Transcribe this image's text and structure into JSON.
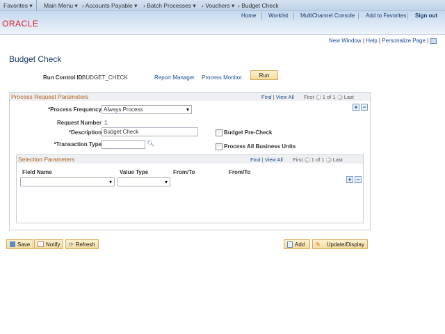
{
  "nav": {
    "favorites": "Favorites",
    "main_menu": "Main Menu",
    "crumbs": [
      "Accounts Payable",
      "Batch Processes",
      "Vouchers"
    ],
    "current": "Budget Check"
  },
  "header": {
    "links": [
      "Home",
      "Worklist",
      "MultiChannel Console",
      "Add to Favorites"
    ],
    "sign_out": "Sign out",
    "logo": "ORACLE"
  },
  "util": {
    "new_window": "New Window",
    "help": "Help",
    "personalize": "Personalize Page"
  },
  "page": {
    "title": "Budget Check",
    "run_control_label": "Run Control ID",
    "run_control_value": "BUDGET_CHECK",
    "report_manager": "Report Manager",
    "process_monitor": "Process Monitor",
    "run": "Run"
  },
  "prp": {
    "title": "Process Request Parameters",
    "find": "Find",
    "view_all": "View All",
    "first": "First",
    "count": "1 of 1",
    "last": "Last",
    "freq_label": "*Process Frequency",
    "freq_value": "Always Process",
    "reqnum_label": "Request Number",
    "reqnum_value": "1",
    "desc_label": "*Description",
    "desc_value": "Budget Check",
    "txn_label": "*Transaction Type",
    "txn_value": "",
    "precheck": "Budget Pre-Check",
    "all_bu": "Process All Business Units"
  },
  "sel": {
    "title": "Selection Parameters",
    "find": "Find",
    "view_all": "View All",
    "first": "First",
    "count": "1 of 1",
    "last": "Last",
    "cols": [
      "Field Name",
      "Value Type",
      "From/To",
      "From/To"
    ]
  },
  "buttons": {
    "save": "Save",
    "notify": "Notify",
    "refresh": "Refresh",
    "add": "Add",
    "update": "Update/Display"
  }
}
